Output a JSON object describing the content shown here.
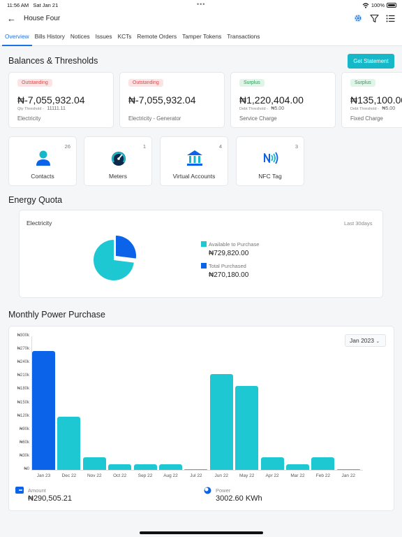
{
  "status": {
    "time": "11:56 AM",
    "date": "Sat Jan 21",
    "battery": "100%"
  },
  "nav": {
    "back_icon": "←",
    "title": "House Four"
  },
  "tabs": [
    "Overview",
    "Bills History",
    "Notices",
    "Issues",
    "KCTs",
    "Remote Orders",
    "Tamper Tokens",
    "Transactions"
  ],
  "balances": {
    "title": "Balances & Thresholds",
    "statement_label": "Get Statement",
    "cards": [
      {
        "badge": "Outstanding",
        "amount": "₦-7,055,932.04",
        "sub_label": "Qty Threshold",
        "sub_value": "11111.11",
        "name": "Electricity"
      },
      {
        "badge": "Outstanding",
        "amount": "₦-7,055,932.04",
        "sub_label": "",
        "sub_value": "",
        "name": "Electricity - Generator"
      },
      {
        "badge": "Surplus",
        "amount": "₦1,220,404.00",
        "sub_label": "Debt Threshold",
        "sub_value": "₦5.00",
        "name": "Service Charge"
      },
      {
        "badge": "Surplus",
        "amount": "₦135,100.00",
        "sub_label": "Debt Threshold",
        "sub_value": "₦5.00",
        "name": "Fixed Charge"
      }
    ]
  },
  "tiles": [
    {
      "label": "Contacts",
      "count": "26"
    },
    {
      "label": "Meters",
      "count": "1"
    },
    {
      "label": "Virtual Accounts",
      "count": "4"
    },
    {
      "label": "NFC Tag",
      "count": "3"
    }
  ],
  "energy_quota": {
    "title": "Energy Quota",
    "label": "Electricity",
    "range": "Last 30days",
    "available_label": "Available to Purchase",
    "available_value": "₦729,820.00",
    "purchased_label": "Total Purchased",
    "purchased_value": "₦270,180.00",
    "available_fraction": 0.7298
  },
  "monthly": {
    "title": "Monthly Power Purchase",
    "selected_month": "Jan 2023",
    "amount_label": "Amount",
    "amount_value": "₦290,505.21",
    "power_label": "Power",
    "power_value": "3002.60 KWh"
  },
  "colors": {
    "accent": "#16b8c8",
    "primary": "#1a73e8",
    "purchased": "#0a63e8",
    "available": "#1ec8d2"
  },
  "chart_data": {
    "type": "bar",
    "categories": [
      "Jan 23",
      "Dec 22",
      "Nov 22",
      "Oct 22",
      "Sep 22",
      "Aug 22",
      "Jul 22",
      "Jun 22",
      "May 22",
      "Apr 22",
      "Mar 22",
      "Feb 22",
      "Jan 22"
    ],
    "values": [
      267000,
      119000,
      29000,
      12000,
      12000,
      12000,
      2000,
      215000,
      189000,
      29000,
      12000,
      29000,
      2000
    ],
    "highlight_index": 0,
    "ytick_labels": [
      "₦0",
      "₦30k",
      "₦60k",
      "₦90k",
      "₦120k",
      "₦150k",
      "₦180k",
      "₦210k",
      "₦240k",
      "₦270k",
      "₦300k"
    ],
    "ylim": [
      0,
      300000
    ],
    "xlabel": "",
    "ylabel": ""
  }
}
